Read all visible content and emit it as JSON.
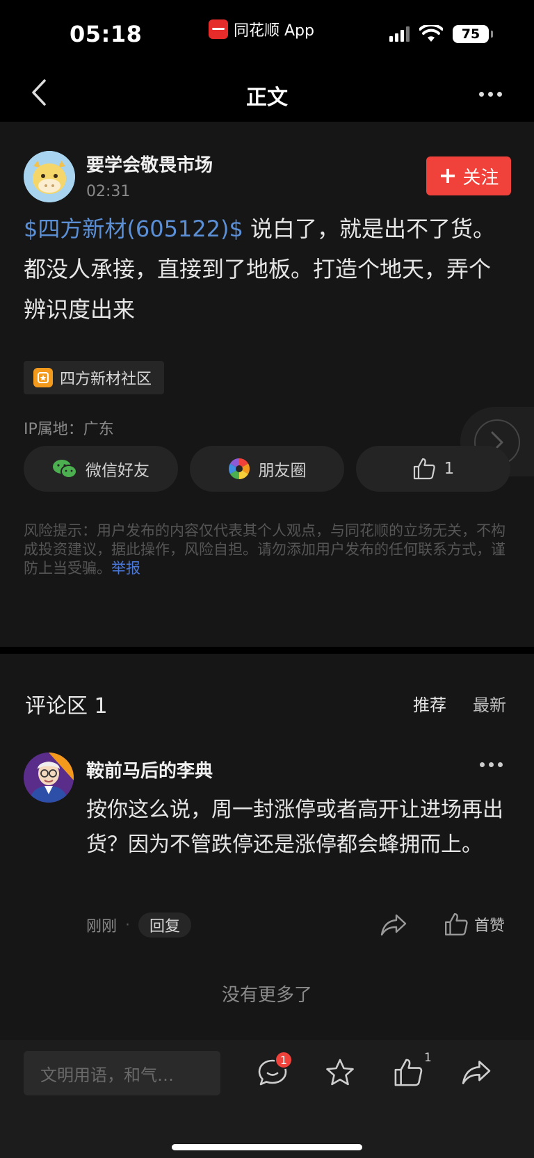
{
  "status_bar": {
    "time": "05:18",
    "app_name": "同花顺 App",
    "battery": "75",
    "icons": [
      "signal-icon",
      "wifi-icon",
      "battery-icon"
    ]
  },
  "nav": {
    "title": "正文",
    "back_icon": "chevron-left-icon",
    "more_icon": "more-dots-icon"
  },
  "post": {
    "author": "要学会敬畏市场",
    "time": "02:31",
    "follow_label": "关注",
    "stock_link": "$四方新材(605122)$",
    "body": " 说白了，就是出不了货。都没人承接，直接到了地板。打造个地天，弄个辨识度出来",
    "community_tag": "四方新材社区",
    "ip_location": "IP属地：广东",
    "share": {
      "wechat_label": "微信好友",
      "moments_label": "朋友圈",
      "like_count": "1"
    },
    "risk_notice": "风险提示：用户发布的内容仅代表其个人观点，与同花顺的立场无关，不构成投资建议，据此操作，风险自担。请勿添加用户发布的任何联系方式，谨防上当受骗。",
    "report_label": "举报"
  },
  "comments": {
    "title": "评论区 1",
    "sort_recommend": "推荐",
    "sort_latest": "最新",
    "items": [
      {
        "author": "鞍前马后的李典",
        "text": "按你这么说，周一封涨停或者高开让进场再出货？因为不管跌停还是涨停都会蜂拥而上。",
        "time": "刚刚",
        "separator": "·",
        "reply_label": "回复",
        "like_label": "首赞"
      }
    ],
    "no_more": "没有更多了"
  },
  "bottom_bar": {
    "input_placeholder": "文明用语，和气…",
    "comment_badge": "1",
    "like_count": "1"
  },
  "colors": {
    "accent_red": "#f0413a",
    "link_blue": "#5b8fd6",
    "background": "#161616"
  }
}
